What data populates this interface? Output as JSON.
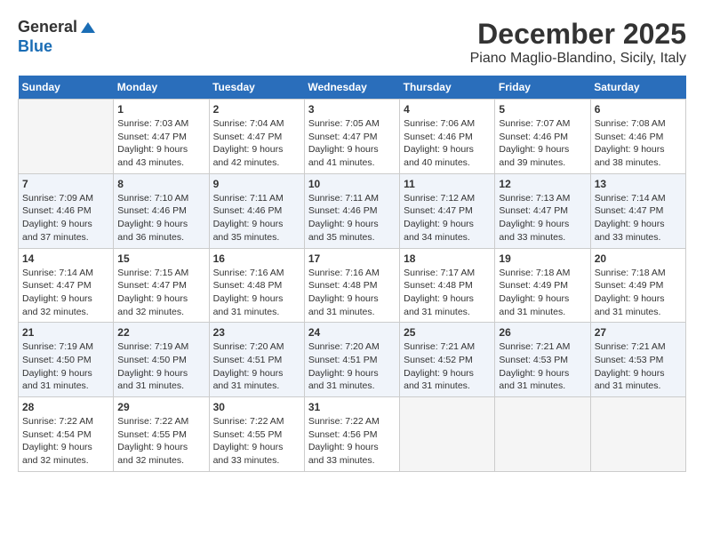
{
  "logo": {
    "general": "General",
    "blue": "Blue"
  },
  "title": "December 2025",
  "subtitle": "Piano Maglio-Blandino, Sicily, Italy",
  "days_header": [
    "Sunday",
    "Monday",
    "Tuesday",
    "Wednesday",
    "Thursday",
    "Friday",
    "Saturday"
  ],
  "weeks": [
    [
      {
        "day": "",
        "info": ""
      },
      {
        "day": "1",
        "info": "Sunrise: 7:03 AM\nSunset: 4:47 PM\nDaylight: 9 hours\nand 43 minutes."
      },
      {
        "day": "2",
        "info": "Sunrise: 7:04 AM\nSunset: 4:47 PM\nDaylight: 9 hours\nand 42 minutes."
      },
      {
        "day": "3",
        "info": "Sunrise: 7:05 AM\nSunset: 4:47 PM\nDaylight: 9 hours\nand 41 minutes."
      },
      {
        "day": "4",
        "info": "Sunrise: 7:06 AM\nSunset: 4:46 PM\nDaylight: 9 hours\nand 40 minutes."
      },
      {
        "day": "5",
        "info": "Sunrise: 7:07 AM\nSunset: 4:46 PM\nDaylight: 9 hours\nand 39 minutes."
      },
      {
        "day": "6",
        "info": "Sunrise: 7:08 AM\nSunset: 4:46 PM\nDaylight: 9 hours\nand 38 minutes."
      }
    ],
    [
      {
        "day": "7",
        "info": "Sunrise: 7:09 AM\nSunset: 4:46 PM\nDaylight: 9 hours\nand 37 minutes."
      },
      {
        "day": "8",
        "info": "Sunrise: 7:10 AM\nSunset: 4:46 PM\nDaylight: 9 hours\nand 36 minutes."
      },
      {
        "day": "9",
        "info": "Sunrise: 7:11 AM\nSunset: 4:46 PM\nDaylight: 9 hours\nand 35 minutes."
      },
      {
        "day": "10",
        "info": "Sunrise: 7:11 AM\nSunset: 4:46 PM\nDaylight: 9 hours\nand 35 minutes."
      },
      {
        "day": "11",
        "info": "Sunrise: 7:12 AM\nSunset: 4:47 PM\nDaylight: 9 hours\nand 34 minutes."
      },
      {
        "day": "12",
        "info": "Sunrise: 7:13 AM\nSunset: 4:47 PM\nDaylight: 9 hours\nand 33 minutes."
      },
      {
        "day": "13",
        "info": "Sunrise: 7:14 AM\nSunset: 4:47 PM\nDaylight: 9 hours\nand 33 minutes."
      }
    ],
    [
      {
        "day": "14",
        "info": "Sunrise: 7:14 AM\nSunset: 4:47 PM\nDaylight: 9 hours\nand 32 minutes."
      },
      {
        "day": "15",
        "info": "Sunrise: 7:15 AM\nSunset: 4:47 PM\nDaylight: 9 hours\nand 32 minutes."
      },
      {
        "day": "16",
        "info": "Sunrise: 7:16 AM\nSunset: 4:48 PM\nDaylight: 9 hours\nand 31 minutes."
      },
      {
        "day": "17",
        "info": "Sunrise: 7:16 AM\nSunset: 4:48 PM\nDaylight: 9 hours\nand 31 minutes."
      },
      {
        "day": "18",
        "info": "Sunrise: 7:17 AM\nSunset: 4:48 PM\nDaylight: 9 hours\nand 31 minutes."
      },
      {
        "day": "19",
        "info": "Sunrise: 7:18 AM\nSunset: 4:49 PM\nDaylight: 9 hours\nand 31 minutes."
      },
      {
        "day": "20",
        "info": "Sunrise: 7:18 AM\nSunset: 4:49 PM\nDaylight: 9 hours\nand 31 minutes."
      }
    ],
    [
      {
        "day": "21",
        "info": "Sunrise: 7:19 AM\nSunset: 4:50 PM\nDaylight: 9 hours\nand 31 minutes."
      },
      {
        "day": "22",
        "info": "Sunrise: 7:19 AM\nSunset: 4:50 PM\nDaylight: 9 hours\nand 31 minutes."
      },
      {
        "day": "23",
        "info": "Sunrise: 7:20 AM\nSunset: 4:51 PM\nDaylight: 9 hours\nand 31 minutes."
      },
      {
        "day": "24",
        "info": "Sunrise: 7:20 AM\nSunset: 4:51 PM\nDaylight: 9 hours\nand 31 minutes."
      },
      {
        "day": "25",
        "info": "Sunrise: 7:21 AM\nSunset: 4:52 PM\nDaylight: 9 hours\nand 31 minutes."
      },
      {
        "day": "26",
        "info": "Sunrise: 7:21 AM\nSunset: 4:53 PM\nDaylight: 9 hours\nand 31 minutes."
      },
      {
        "day": "27",
        "info": "Sunrise: 7:21 AM\nSunset: 4:53 PM\nDaylight: 9 hours\nand 31 minutes."
      }
    ],
    [
      {
        "day": "28",
        "info": "Sunrise: 7:22 AM\nSunset: 4:54 PM\nDaylight: 9 hours\nand 32 minutes."
      },
      {
        "day": "29",
        "info": "Sunrise: 7:22 AM\nSunset: 4:55 PM\nDaylight: 9 hours\nand 32 minutes."
      },
      {
        "day": "30",
        "info": "Sunrise: 7:22 AM\nSunset: 4:55 PM\nDaylight: 9 hours\nand 33 minutes."
      },
      {
        "day": "31",
        "info": "Sunrise: 7:22 AM\nSunset: 4:56 PM\nDaylight: 9 hours\nand 33 minutes."
      },
      {
        "day": "",
        "info": ""
      },
      {
        "day": "",
        "info": ""
      },
      {
        "day": "",
        "info": ""
      }
    ]
  ]
}
